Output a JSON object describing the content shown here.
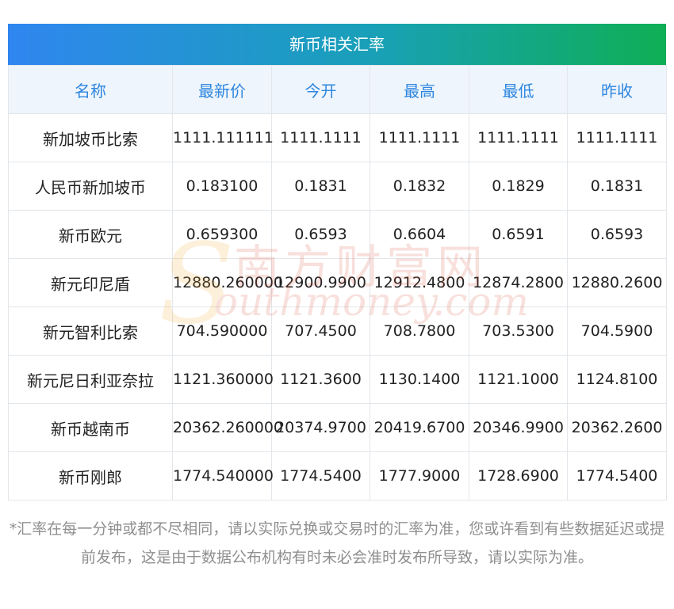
{
  "title": "新币相关汇率",
  "columns": [
    "名称",
    "最新价",
    "今开",
    "最高",
    "最低",
    "昨收"
  ],
  "rows": [
    {
      "name": "新加坡币比索",
      "latest": "1111.111111",
      "open": "1111.1111",
      "high": "1111.1111",
      "low": "1111.1111",
      "prev": "1111.1111"
    },
    {
      "name": "人民币新加坡币",
      "latest": "0.183100",
      "open": "0.1831",
      "high": "0.1832",
      "low": "0.1829",
      "prev": "0.1831"
    },
    {
      "name": "新币欧元",
      "latest": "0.659300",
      "open": "0.6593",
      "high": "0.6604",
      "low": "0.6591",
      "prev": "0.6593"
    },
    {
      "name": "新元印尼盾",
      "latest": "12880.260000",
      "open": "12900.9900",
      "high": "12912.4800",
      "low": "12874.2800",
      "prev": "12880.2600"
    },
    {
      "name": "新元智利比索",
      "latest": "704.590000",
      "open": "707.4500",
      "high": "708.7800",
      "low": "703.5300",
      "prev": "704.5900"
    },
    {
      "name": "新元尼日利亚奈拉",
      "latest": "1121.360000",
      "open": "1121.3600",
      "high": "1130.1400",
      "low": "1121.1000",
      "prev": "1124.8100"
    },
    {
      "name": "新币越南币",
      "latest": "20362.260000",
      "open": "20374.9700",
      "high": "20419.6700",
      "low": "20346.9900",
      "prev": "20362.2600"
    },
    {
      "name": "新币刚郎",
      "latest": "1774.540000",
      "open": "1774.5400",
      "high": "1777.9000",
      "low": "1728.6900",
      "prev": "1774.5400"
    }
  ],
  "note": "*汇率在每一分钟或都不尽相同，请以实际兑换或交易时的汇率为准，您或许看到有些数据延迟或提前发布，这是由于数据公布机构有时未必会准时发布所导致，请以实际为准。",
  "watermark": {
    "cn": "南方财富网",
    "en": "outhmoney.com",
    "s": "S"
  },
  "colors": {
    "header_text": "#2e86de",
    "gradient_start": "#2f86f0",
    "gradient_end": "#0fae55",
    "note_text": "#8f8f8f"
  }
}
